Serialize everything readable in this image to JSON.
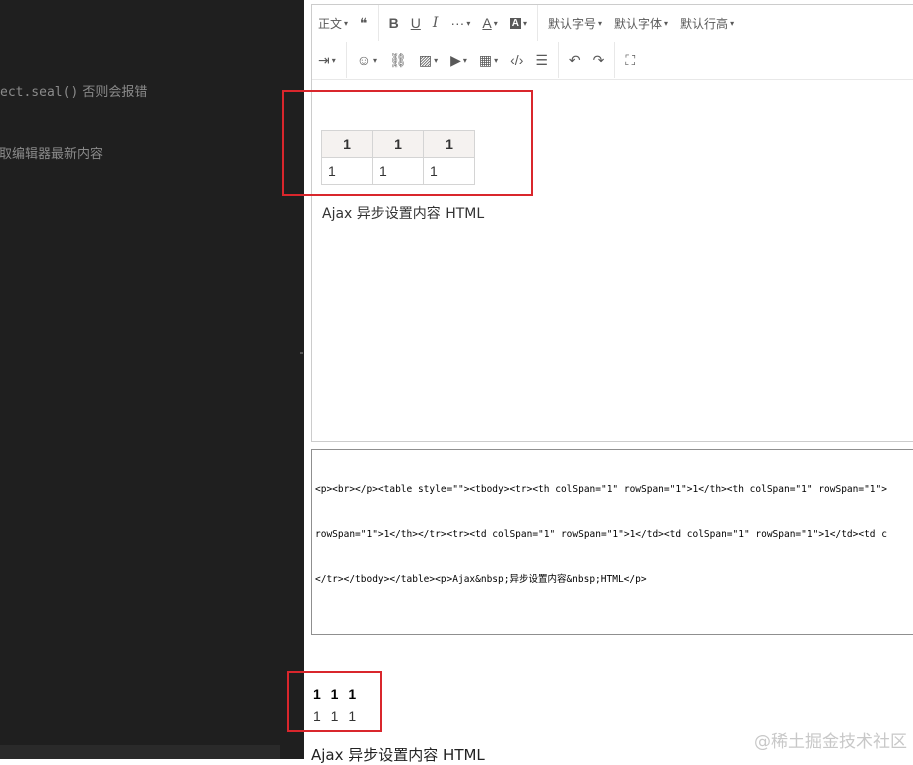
{
  "code_pane": {
    "line1_code": "ect.seal()",
    "line1_comment": " 否则会报错",
    "line2_comment": "获取编辑器最新内容"
  },
  "toolbar": {
    "row1": [
      {
        "name": "paragraph-format-dropdown",
        "label": "正文",
        "caret": true
      },
      {
        "name": "blockquote-button",
        "label": "❝",
        "caret": false
      },
      {
        "sep": true
      },
      {
        "name": "bold-button",
        "label": "B",
        "caret": false
      },
      {
        "name": "underline-button",
        "label": "U",
        "caret": false
      },
      {
        "name": "italic-button",
        "label": "I",
        "caret": false
      },
      {
        "name": "more-styles-dropdown",
        "label": "···",
        "caret": true
      },
      {
        "name": "font-color-dropdown",
        "label": "A",
        "caret": true
      },
      {
        "name": "background-color-dropdown",
        "label": "A",
        "caret": true
      },
      {
        "sep": true
      },
      {
        "name": "font-size-dropdown",
        "label": "默认字号",
        "caret": true
      },
      {
        "name": "font-family-dropdown",
        "label": "默认字体",
        "caret": true
      },
      {
        "name": "line-height-dropdown",
        "label": "默认行高",
        "caret": true
      }
    ],
    "row2": [
      {
        "name": "indent-dropdown",
        "label": "⇥",
        "caret": true
      },
      {
        "sep": true
      },
      {
        "name": "emotion-dropdown",
        "label": "☺",
        "caret": true
      },
      {
        "name": "insert-link-button",
        "label": "⛓",
        "caret": false
      },
      {
        "name": "insert-image-dropdown",
        "label": "▨",
        "caret": true
      },
      {
        "name": "insert-video-dropdown",
        "label": "▶",
        "caret": true
      },
      {
        "name": "insert-table-dropdown",
        "label": "▦",
        "caret": true
      },
      {
        "name": "code-block-button",
        "label": "‹/›",
        "caret": false
      },
      {
        "name": "divider-button",
        "label": "☰",
        "caret": false
      },
      {
        "sep": true
      },
      {
        "name": "undo-button",
        "label": "↶",
        "caret": false
      },
      {
        "name": "redo-button",
        "label": "↷",
        "caret": false
      },
      {
        "sep": true
      },
      {
        "name": "fullscreen-button",
        "label": "⛶",
        "caret": false
      }
    ],
    "caret_symbol": "▾"
  },
  "editor": {
    "table": {
      "headers": [
        "1",
        "1",
        "1"
      ],
      "rows": [
        [
          "1",
          "1",
          "1"
        ]
      ]
    },
    "text": "Ajax 异步设置内容 HTML"
  },
  "html_output": {
    "lines": [
      "<p><br></p><table style=\"\"><tbody><tr><th colSpan=\"1\" rowSpan=\"1\">1</th><th colSpan=\"1\" rowSpan=\"1\">",
      "rowSpan=\"1\">1</th></tr><tr><td colSpan=\"1\" rowSpan=\"1\">1</td><td colSpan=\"1\" rowSpan=\"1\">1</td><td c",
      "</tr></tbody></table><p>Ajax&nbsp;异步设置内容&nbsp;HTML</p>"
    ]
  },
  "preview": {
    "header_row": "1 1 1",
    "data_row": "1 1 1",
    "text": "Ajax 异步设置内容 HTML"
  },
  "watermark": "@稀土掘金技术社区",
  "colors": {
    "highlight_border": "#d9262c",
    "code_bg": "#1f1f1f",
    "table_header_bg": "#f5f2f0"
  }
}
